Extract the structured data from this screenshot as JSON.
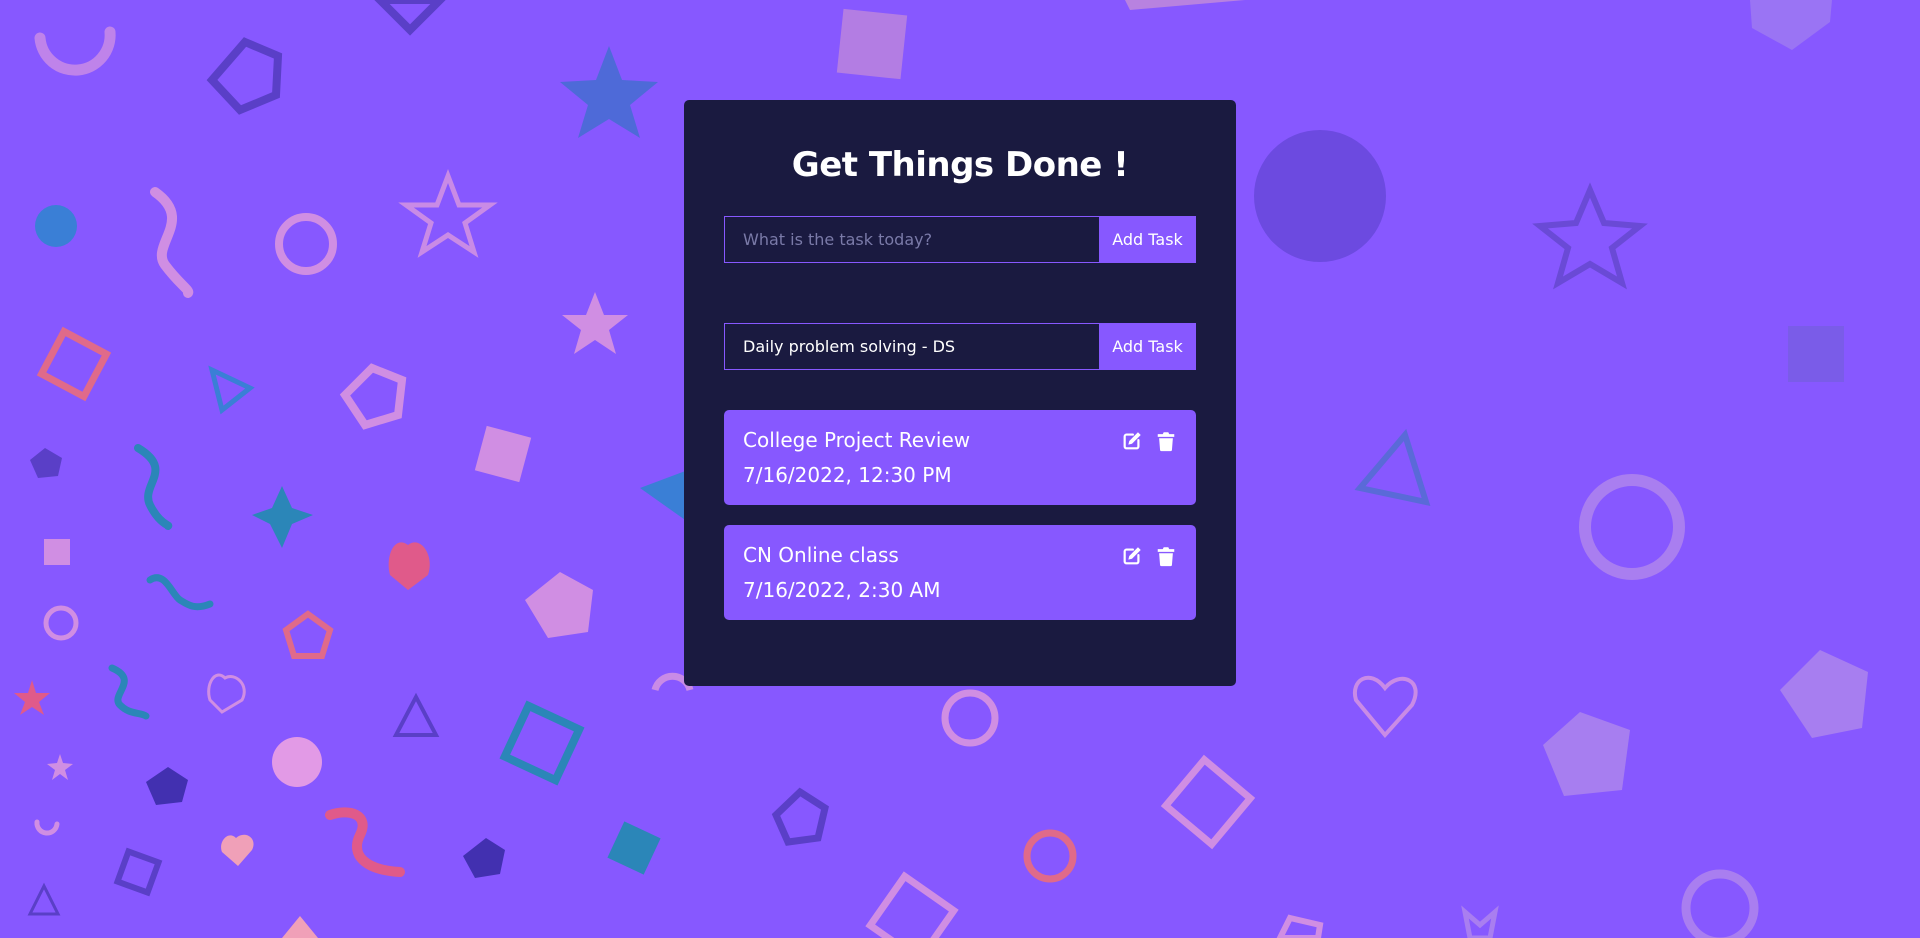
{
  "app": {
    "heading": "Get Things Done !"
  },
  "new_task_form": {
    "input_value": "",
    "input_placeholder": "What is the task today?",
    "button_label": "Add Task"
  },
  "edit_task_form": {
    "input_value": "Daily problem solving - DS",
    "button_label": "Add Task"
  },
  "todos": [
    {
      "title": "College Project Review",
      "datetime": "7/16/2022, 12:30 PM",
      "edit_icon": "edit-icon",
      "delete_icon": "trash-icon"
    },
    {
      "title": "CN Online class",
      "datetime": "7/16/2022, 2:30 AM",
      "edit_icon": "edit-icon",
      "delete_icon": "trash-icon"
    }
  ],
  "colors": {
    "background": "#8758ff",
    "card": "#1a1a40",
    "accent": "#8758ff",
    "text": "#ffffff"
  }
}
